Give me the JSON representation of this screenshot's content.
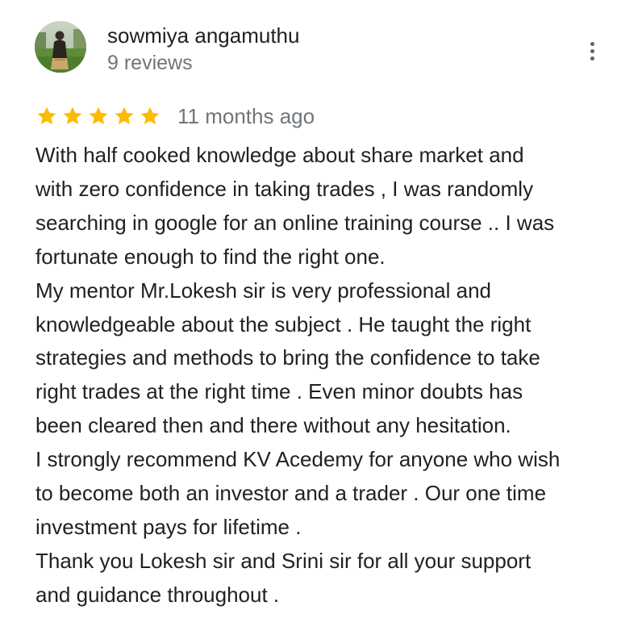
{
  "reviewer": {
    "name": "sowmiya angamuthu",
    "review_count": "9 reviews",
    "avatar_icon": "profile-photo"
  },
  "menu": {
    "icon": "more-vert-icon"
  },
  "rating": {
    "stars": 5,
    "max_stars": 5,
    "star_color": "#fbbc04",
    "date": "11 months ago"
  },
  "review": {
    "lines": [
      "With half cooked knowledge about share market and",
      "with zero confidence in taking trades , I was randomly",
      "searching in google for an online training course .. I was",
      "fortunate enough to find the right one.",
      "My mentor Mr.Lokesh sir is very professional and",
      "knowledgeable about the subject . He taught the right",
      "strategies and methods to bring the confidence to take",
      "right trades at the right time . Even minor doubts has",
      "been cleared then and there without any hesitation.",
      "I strongly recommend KV Acedemy for anyone who wish",
      "to become both an investor and a trader . Our one time",
      "investment pays for lifetime .",
      "Thank you Lokesh sir and Srini sir for all your support",
      "and guidance throughout ."
    ]
  },
  "colors": {
    "text_primary": "#202124",
    "text_secondary": "#70757a",
    "icon_gray": "#5f6368"
  }
}
